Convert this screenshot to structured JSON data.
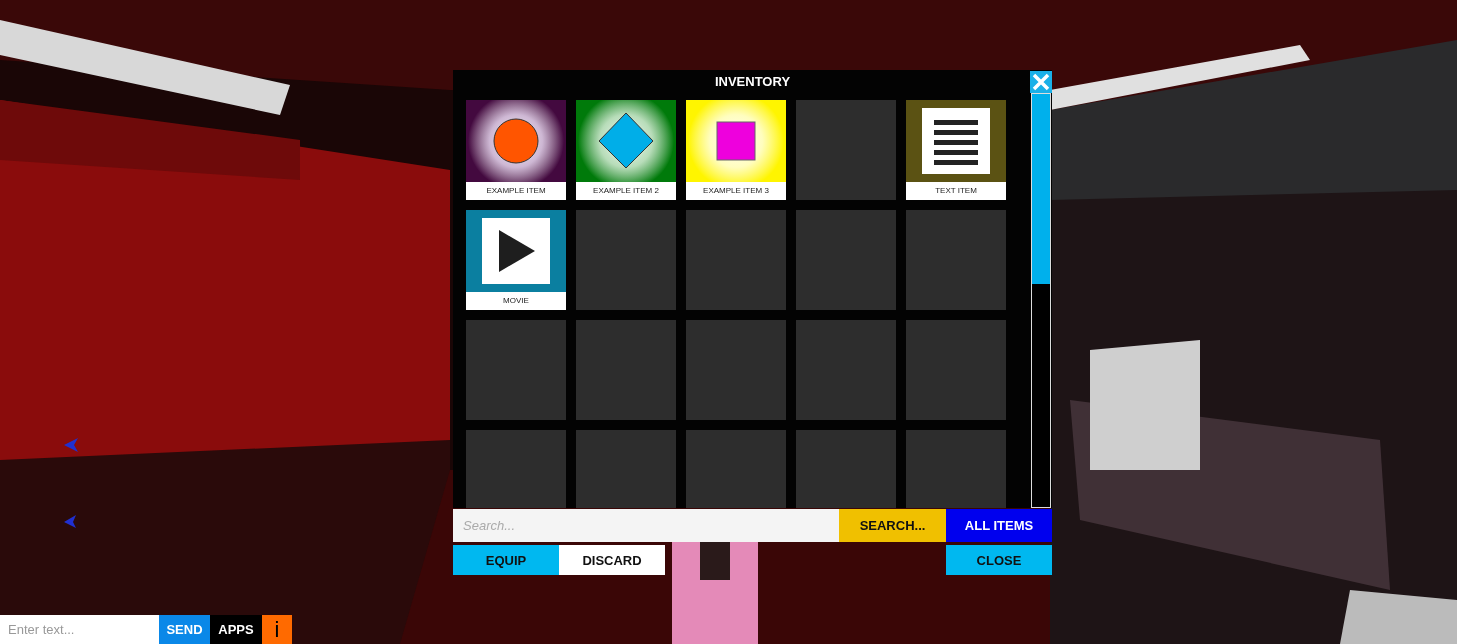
{
  "inventory": {
    "title": "INVENTORY",
    "slots": [
      {
        "kind": "circle",
        "label": "EXAMPLE ITEM",
        "color": "#43093f"
      },
      {
        "kind": "diamond",
        "label": "EXAMPLE ITEM 2",
        "color": "#007a0a"
      },
      {
        "kind": "square",
        "label": "EXAMPLE ITEM 3",
        "color": "#fff500"
      },
      {
        "kind": "empty"
      },
      {
        "kind": "lines",
        "label": "TEXT ITEM",
        "color": "#5b5213"
      },
      {
        "kind": "play",
        "label": "MOVIE",
        "color": "#0b7fa0"
      },
      {
        "kind": "empty"
      },
      {
        "kind": "empty"
      },
      {
        "kind": "empty"
      },
      {
        "kind": "empty"
      },
      {
        "kind": "empty"
      },
      {
        "kind": "empty"
      },
      {
        "kind": "empty"
      },
      {
        "kind": "empty"
      },
      {
        "kind": "empty"
      },
      {
        "kind": "empty"
      },
      {
        "kind": "empty"
      },
      {
        "kind": "empty"
      },
      {
        "kind": "empty"
      },
      {
        "kind": "empty"
      }
    ],
    "search": {
      "placeholder": "Search..."
    },
    "search_button": "SEARCH...",
    "all_items_button": "ALL ITEMS",
    "equip_button": "EQUIP",
    "discard_button": "DISCARD",
    "close_button": "CLOSE"
  },
  "chat": {
    "placeholder": "Enter text...",
    "send_button": "SEND",
    "apps_button": "APPS",
    "info_button": "i"
  }
}
